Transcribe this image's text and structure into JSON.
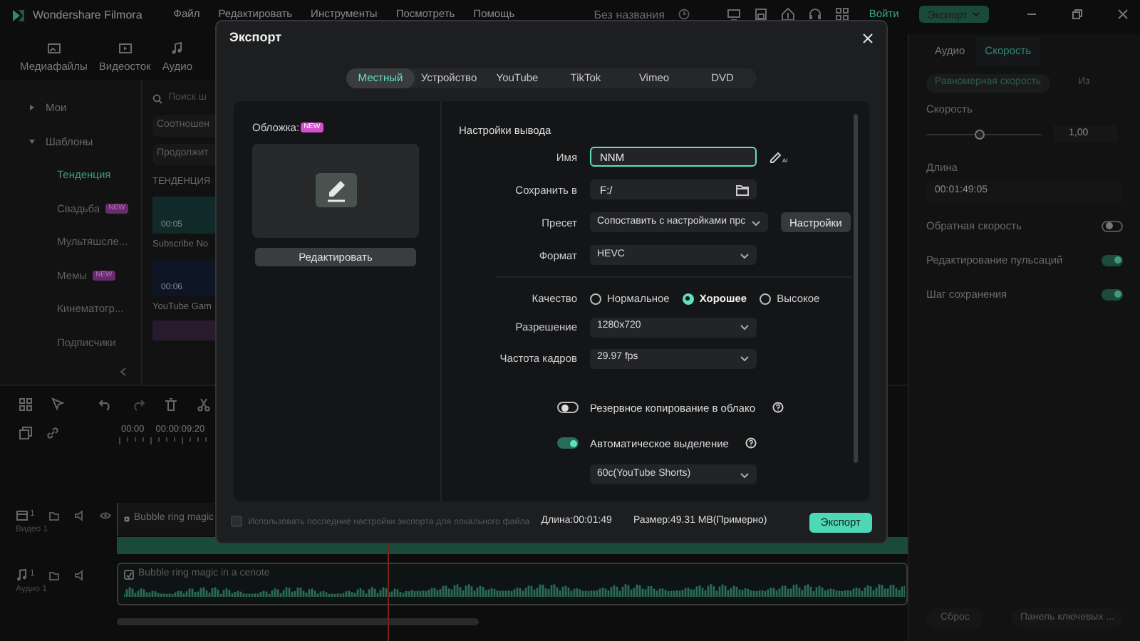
{
  "title_bar": {
    "app_name": "Wondershare Filmora",
    "menu": [
      "Файл",
      "Редактировать",
      "Инструменты",
      "Посмотреть",
      "Помощь"
    ],
    "document_title": "Без названия",
    "sign_in": "Войти",
    "export_button": "Экспорт"
  },
  "toolbar": [
    {
      "label": "Медиафайлы"
    },
    {
      "label": "Видеосток"
    },
    {
      "label": "Аудио"
    }
  ],
  "sidebar": {
    "items": [
      {
        "label": "Мои",
        "expanded": false,
        "selected": false
      },
      {
        "label": "Шаблоны",
        "expanded": true,
        "selected": false,
        "children": [
          {
            "label": "Тенденция",
            "selected": true
          },
          {
            "label": "Свадьба",
            "selected": false,
            "badge": "NEW"
          },
          {
            "label": "Мультяшсле...",
            "selected": false
          },
          {
            "label": "Мемы",
            "selected": false,
            "badge": "NEW"
          },
          {
            "label": "Кинематогр...",
            "selected": false
          },
          {
            "label": "Подписчики",
            "selected": false
          }
        ]
      }
    ]
  },
  "media": {
    "search_placeholder": "Поиск ш",
    "filters": [
      "Соотношен",
      "Продолжит"
    ],
    "section": "ТЕНДЕНЦИЯ",
    "items": [
      {
        "duration": "00:05",
        "title": "Subscribe No"
      },
      {
        "duration": "00:06",
        "title": "YouTube Gam"
      }
    ]
  },
  "timeline": {
    "ruler": [
      "00:00",
      "00:00:09:20"
    ],
    "tracks": [
      {
        "kind": "video",
        "number": "1",
        "name": "Видео 1",
        "clip": "Bubble ring magic"
      },
      {
        "kind": "audio",
        "number": "1",
        "name": "Аудио 1",
        "clip": "Bubble ring magic in a cenote"
      }
    ]
  },
  "right_panel": {
    "tabs": [
      {
        "label": "Аудио",
        "selected": false
      },
      {
        "label": "Скорость",
        "selected": true
      }
    ],
    "modes": [
      {
        "label": "Равномерная скорость",
        "selected": true
      },
      {
        "label": "Из",
        "selected": false
      }
    ],
    "speed": {
      "label": "Скорость",
      "level": 0.46,
      "value": "1,00"
    },
    "duration": {
      "label": "Длина",
      "value": "00:01:49:05"
    },
    "toggles": [
      {
        "label": "Обратная скорость",
        "on": false
      },
      {
        "label": "Редактирование пульсаций",
        "on": true
      },
      {
        "label": "Шаг сохранения",
        "on": true
      }
    ],
    "buttons": [
      "Сброс",
      "Панель ключевых ..."
    ]
  },
  "export_dialog": {
    "title": "Экспорт",
    "tabs": [
      {
        "label": "Местный",
        "selected": true
      },
      {
        "label": "Устройство",
        "selected": false
      },
      {
        "label": "YouTube",
        "selected": false
      },
      {
        "label": "TikTok",
        "selected": false
      },
      {
        "label": "Vimeo",
        "selected": false
      },
      {
        "label": "DVD",
        "selected": false
      }
    ],
    "cover": {
      "label": "Обложка:",
      "badge": "NEW",
      "edit_button": "Редактировать"
    },
    "output": {
      "heading": "Настройки вывода",
      "fields": [
        {
          "kind": "text",
          "label": "Имя",
          "value": "NNM",
          "focused": true,
          "ai_mark": "AI"
        },
        {
          "kind": "path",
          "label": "Сохранить в",
          "value": "F:/",
          "focused": false
        },
        {
          "kind": "select",
          "label": "Пресет",
          "value": "Сопоставить с настройками прс",
          "button": "Настройки",
          "focused": false
        },
        {
          "kind": "select",
          "label": "Формат",
          "value": "HEVC",
          "focused": false
        }
      ],
      "quality": {
        "label": "Качество",
        "options": [
          {
            "label": "Нормальное",
            "selected": false
          },
          {
            "label": "Хорошее",
            "selected": true
          },
          {
            "label": "Высокое",
            "selected": false
          }
        ]
      },
      "video_fields": [
        {
          "label": "Разрешение",
          "value": "1280x720"
        },
        {
          "label": "Частота кадров",
          "value": "29.97 fps"
        }
      ],
      "toggles": [
        {
          "label": "Резервное копирование в облако",
          "on": false
        },
        {
          "label": "Автоматическое выделение",
          "on": true
        }
      ],
      "highlight_length": "60c(YouTube Shorts)"
    },
    "footer": {
      "use_last": {
        "label": "Использовать последние настройки экспорта для локального файла",
        "checked": false
      },
      "length": "Длина:00:01:49",
      "size": "Размер:49.31 MB(Примерно)",
      "export_button": "Экспорт"
    }
  }
}
